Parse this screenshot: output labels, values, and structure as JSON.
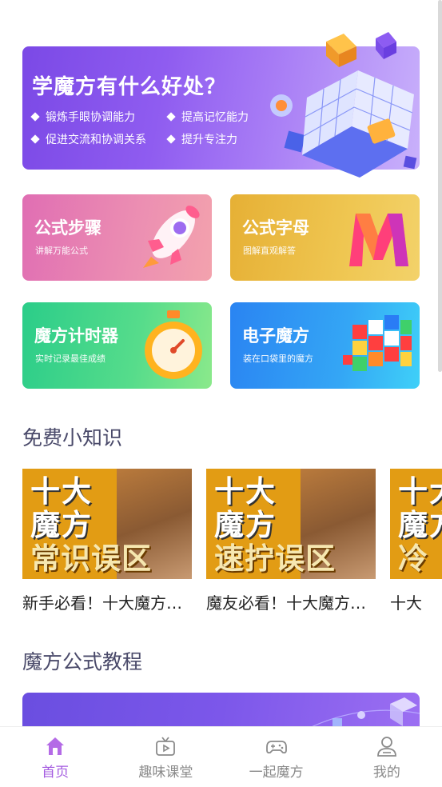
{
  "hero": {
    "title": "学魔方有什么好处？",
    "benefits": [
      "锻炼手眼协调能力",
      "提高记忆能力",
      "促进交流和协调关系",
      "提升专注力"
    ]
  },
  "features": [
    {
      "title": "公式步骤",
      "subtitle": "讲解万能公式"
    },
    {
      "title": "公式字母",
      "subtitle": "图解直观解答"
    },
    {
      "title": "魔方计时器",
      "subtitle": "实时记录最佳成绩"
    },
    {
      "title": "电子魔方",
      "subtitle": "装在口袋里的魔方"
    }
  ],
  "knowledge": {
    "section_title": "免费小知识",
    "items": [
      {
        "line1": "十大",
        "line2": "魔方",
        "line3": "常识误区",
        "caption": "新手必看！十大魔方常识误区"
      },
      {
        "line1": "十大",
        "line2": "魔方",
        "line3": "速拧误区",
        "caption": "魔友必看！十大魔方速拧误区"
      },
      {
        "line1": "十大",
        "line2": "魔方",
        "line3": "冷",
        "caption": "十大"
      }
    ]
  },
  "tutorial": {
    "section_title": "魔方公式教程"
  },
  "tabbar": {
    "active_color": "#a45be0",
    "tabs": [
      {
        "label": "首页",
        "icon": "home-icon",
        "active": true
      },
      {
        "label": "趣味课堂",
        "icon": "tv-icon",
        "active": false
      },
      {
        "label": "一起魔方",
        "icon": "gamepad-icon",
        "active": false
      },
      {
        "label": "我的",
        "icon": "user-icon",
        "active": false
      }
    ]
  }
}
